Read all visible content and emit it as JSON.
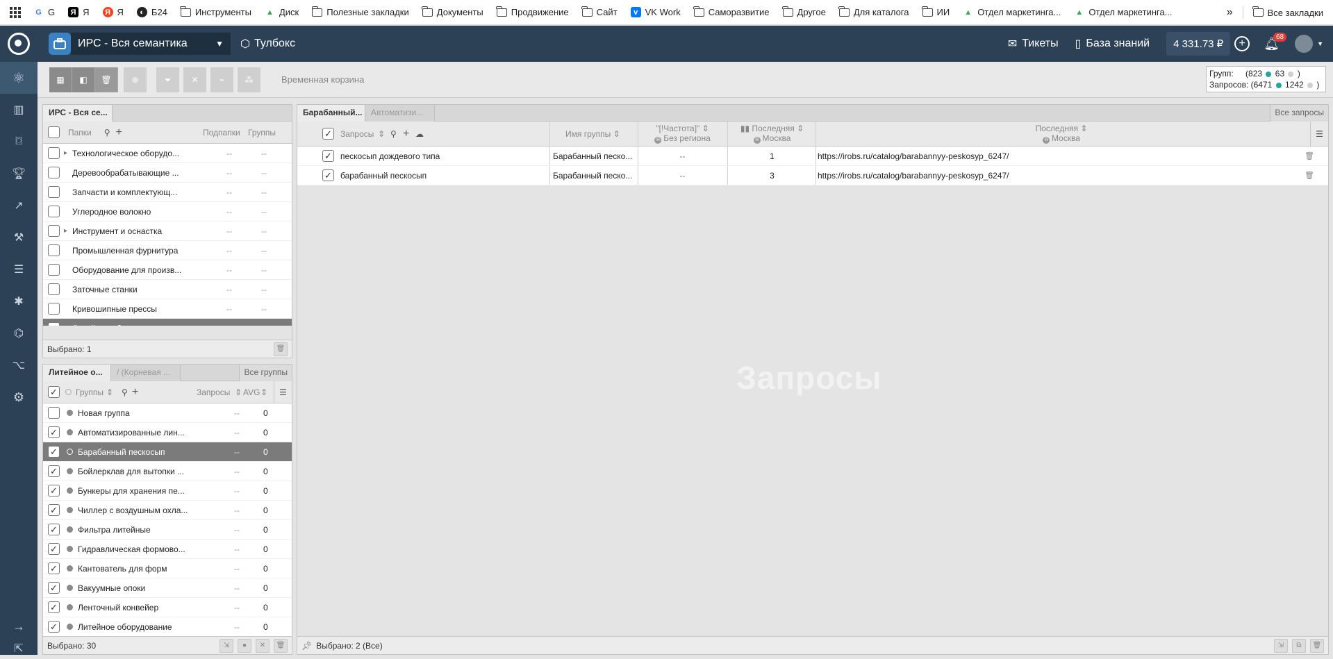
{
  "bookmarks": {
    "items": [
      {
        "label": "G",
        "icon": "google-icon"
      },
      {
        "label": "Я",
        "icon": "yandex-black-icon"
      },
      {
        "label": "Я",
        "icon": "yandex-red-icon"
      },
      {
        "label": "Б24",
        "icon": "b24-icon"
      },
      {
        "label": "Инструменты",
        "icon": "folder-icon"
      },
      {
        "label": "Диск",
        "icon": "drive-icon"
      },
      {
        "label": "Полезные закладки",
        "icon": "folder-icon"
      },
      {
        "label": "Документы",
        "icon": "folder-icon"
      },
      {
        "label": "Продвижение",
        "icon": "folder-icon"
      },
      {
        "label": "Сайт",
        "icon": "folder-icon"
      },
      {
        "label": "VK Work",
        "icon": "vk-icon"
      },
      {
        "label": "Саморазвитие",
        "icon": "folder-icon"
      },
      {
        "label": "Другое",
        "icon": "folder-icon"
      },
      {
        "label": "Для каталога",
        "icon": "folder-icon"
      },
      {
        "label": "ИИ",
        "icon": "folder-icon"
      },
      {
        "label": "Отдел маркетинга...",
        "icon": "drive-icon"
      },
      {
        "label": "Отдел маркетинга...",
        "icon": "drive-icon"
      }
    ],
    "more": "»",
    "all_bookmarks": "Все закладки"
  },
  "header": {
    "project": "ИРС - Вся семантика",
    "turbo": "Тулбокс",
    "tickets": "Тикеты",
    "knowledge": "База знаний",
    "balance": "4 331.73 ₽",
    "notif_count": "68"
  },
  "toolbar": {
    "temp_basket": "Временная корзина",
    "stats": {
      "groups_label": "Групп:",
      "groups_total": "(823",
      "groups_green": "63",
      "groups_close": ")",
      "queries_label": "Запросов:",
      "queries_total": "(6471",
      "queries_green": "1242",
      "queries_close": ")"
    }
  },
  "folders_panel": {
    "tab": "ИРС - Вся се...",
    "col_folders": "Папки",
    "col_subfolders": "Подпапки",
    "col_groups": "Группы",
    "rows": [
      {
        "name": "Технологическое оборудо...",
        "sub": "--",
        "groups": "--",
        "arrow": true,
        "checked": false,
        "selected": false
      },
      {
        "name": "Деревообрабатывающие ...",
        "sub": "--",
        "groups": "--",
        "arrow": false,
        "checked": false,
        "selected": false
      },
      {
        "name": "Запчасти и комплектующ...",
        "sub": "--",
        "groups": "--",
        "arrow": false,
        "checked": false,
        "selected": false
      },
      {
        "name": "Углеродное волокно",
        "sub": "--",
        "groups": "--",
        "arrow": false,
        "checked": false,
        "selected": false
      },
      {
        "name": "Инструмент и оснастка",
        "sub": "--",
        "groups": "--",
        "arrow": true,
        "checked": false,
        "selected": false
      },
      {
        "name": "Промышленная фурнитура",
        "sub": "--",
        "groups": "--",
        "arrow": false,
        "checked": false,
        "selected": false
      },
      {
        "name": "Оборудование для произв...",
        "sub": "--",
        "groups": "--",
        "arrow": false,
        "checked": false,
        "selected": false
      },
      {
        "name": "Заточные станки",
        "sub": "--",
        "groups": "--",
        "arrow": false,
        "checked": false,
        "selected": false
      },
      {
        "name": "Кривошипные прессы",
        "sub": "--",
        "groups": "--",
        "arrow": false,
        "checked": false,
        "selected": false
      },
      {
        "name": "Литейное оборудование",
        "sub": "--",
        "groups": "--",
        "arrow": false,
        "checked": true,
        "selected": true
      }
    ],
    "footer": "Выбрано: 1"
  },
  "groups_panel": {
    "tab1": "Литейное о...",
    "tab2": "/ (Корневая ...",
    "all_groups": "Все группы",
    "col_groups": "Группы",
    "col_queries": "Запросы",
    "col_avg": "AVG",
    "rows": [
      {
        "name": "Новая группа",
        "q": "--",
        "avg": "0",
        "checked": false,
        "selected": false
      },
      {
        "name": "Автоматизированные лин...",
        "q": "--",
        "avg": "0",
        "checked": true,
        "selected": false
      },
      {
        "name": "Барабанный пескосып",
        "q": "--",
        "avg": "0",
        "checked": true,
        "selected": true
      },
      {
        "name": "Бойлерклав для вытопки ...",
        "q": "--",
        "avg": "0",
        "checked": true,
        "selected": false
      },
      {
        "name": "Бункеры для хранения пе...",
        "q": "--",
        "avg": "0",
        "checked": true,
        "selected": false
      },
      {
        "name": "Чиллер с воздушным охла...",
        "q": "--",
        "avg": "0",
        "checked": true,
        "selected": false
      },
      {
        "name": "Фильтра литейные",
        "q": "--",
        "avg": "0",
        "checked": true,
        "selected": false
      },
      {
        "name": "Гидравлическая формово...",
        "q": "--",
        "avg": "0",
        "checked": true,
        "selected": false
      },
      {
        "name": "Кантователь для форм",
        "q": "--",
        "avg": "0",
        "checked": true,
        "selected": false
      },
      {
        "name": "Вакуумные опоки",
        "q": "--",
        "avg": "0",
        "checked": true,
        "selected": false
      },
      {
        "name": "Ленточный конвейер",
        "q": "--",
        "avg": "0",
        "checked": true,
        "selected": false
      },
      {
        "name": "Литейное оборудование",
        "q": "--",
        "avg": "0",
        "checked": true,
        "selected": false
      }
    ],
    "footer": "Выбрано: 30"
  },
  "queries_panel": {
    "tab1": "Барабанный...",
    "tab2": "Автоматизи...",
    "all_queries": "Все запросы",
    "col_queries": "Запросы",
    "col_group": "Имя группы",
    "col_freq_top": "\"[!Частота]\"",
    "col_freq_bottom": "Без региона",
    "col_last_top": "Последняя",
    "col_last_bottom": "Москва",
    "col_url_top": "Последняя",
    "col_url_bottom": "Москва",
    "rows": [
      {
        "query": "пескосып дождевого типа",
        "group": "Барабанный песко...",
        "freq": "--",
        "last": "1",
        "url": "https://irobs.ru/catalog/barabannyy-peskosyp_6247/"
      },
      {
        "query": "барабанный пескосып",
        "group": "Барабанный песко...",
        "freq": "--",
        "last": "3",
        "url": "https://irobs.ru/catalog/barabannyy-peskosyp_6247/"
      }
    ],
    "watermark": "Запросы",
    "footer": "Выбрано: 2 (Все)"
  }
}
